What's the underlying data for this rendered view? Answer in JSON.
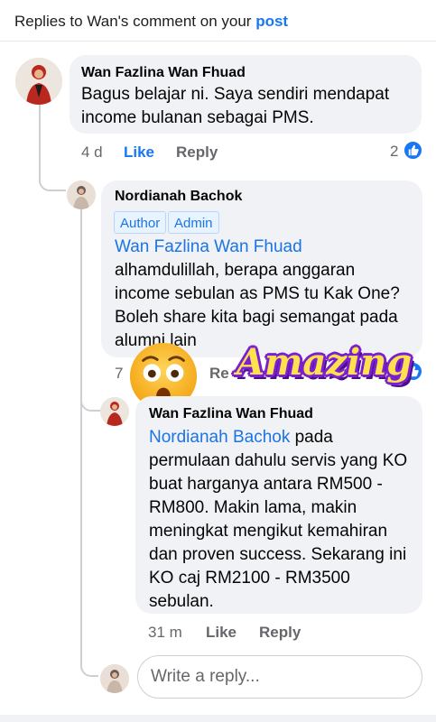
{
  "header": {
    "prefix": "Replies to Wan's comment on your",
    "link": "post"
  },
  "comment_main": {
    "author": "Wan Fazlina Wan Fhuad",
    "text": "Bagus belajar ni. Saya sendiri mendapat income bulanan sebagai PMS.",
    "time": "4 d",
    "like_label": "Like",
    "reply_label": "Reply",
    "reaction_count": "2",
    "reaction_icon": "like-icon"
  },
  "comment_reply1": {
    "author": "Nordianah Bachok",
    "badges": [
      "Author",
      "Admin"
    ],
    "mention": "Wan Fazlina Wan Fhuad",
    "text": "alhamdulillah, berapa anggaran income sebulan as PMS tu Kak One? Boleh share kita bagi semangat pada alumni lain",
    "time_partial": "7",
    "reply_partial": "Re",
    "reaction_count_partial": "1",
    "reaction_icon": "like-icon"
  },
  "comment_reply2": {
    "author": "Wan Fazlina Wan Fhuad",
    "mention": "Nordianah Bachok",
    "text_first": "pada",
    "text": "permulaan dahulu servis yang KO buat harganya antara RM500 - RM800. Makin lama, makin meningkat mengikut kemahiran dan proven success. Sekarang ini KO caj RM2100 - RM3500 sebulan.",
    "time": "31 m",
    "like_label": "Like",
    "reply_label": "Reply"
  },
  "reply_box": {
    "placeholder": "Write a reply..."
  },
  "stickers": {
    "emoji": "shocked-face-emoji",
    "text": "Amazing"
  },
  "colors": {
    "accent": "#1877f2",
    "bubble": "#f0f2f5",
    "muted": "#65676b",
    "sticker_fill": "#ffe14d",
    "sticker_outline": "#7a1fd1"
  }
}
